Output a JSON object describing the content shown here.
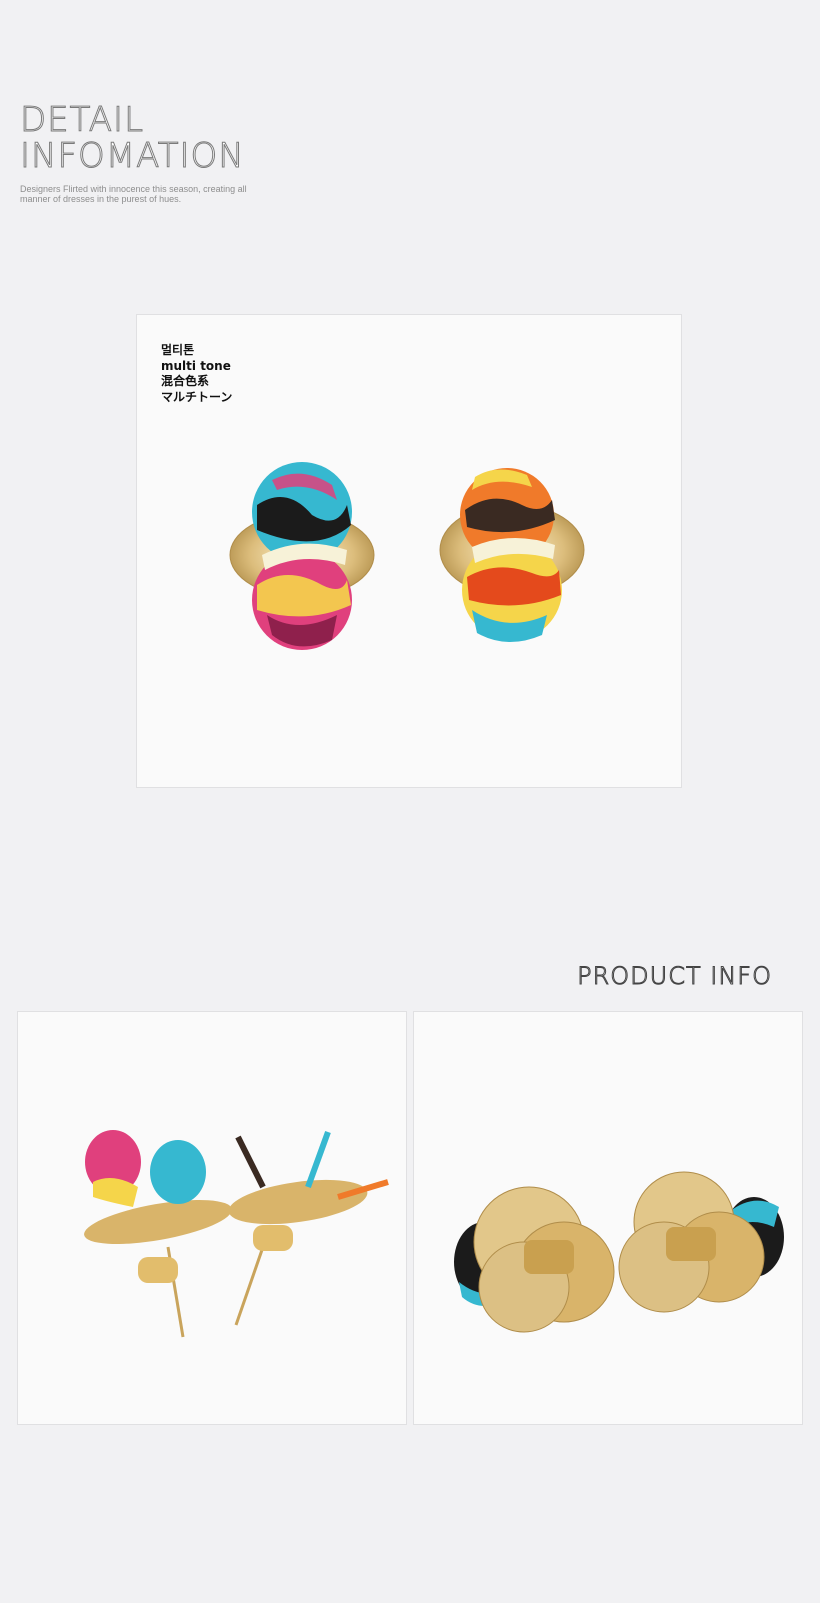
{
  "header": {
    "title_line1": "DETAIL",
    "title_line2": "INFOMATION",
    "subtitle": "Designers Flirted with innocence this season, creating all manner of dresses in the purest of hues."
  },
  "main_panel": {
    "color_labels": [
      "멀티톤",
      "multi tone",
      "混合色系",
      "マルチトーン"
    ]
  },
  "product_info": {
    "heading": "PRODUCT INFO"
  },
  "colors": {
    "page_background": "#f1f1f3",
    "panel_background": "#fafafa",
    "gold": "#d9b46a",
    "pink": "#e0407d",
    "cyan": "#36b8d0",
    "orange": "#f07a2a",
    "yellow": "#f5d54a"
  }
}
